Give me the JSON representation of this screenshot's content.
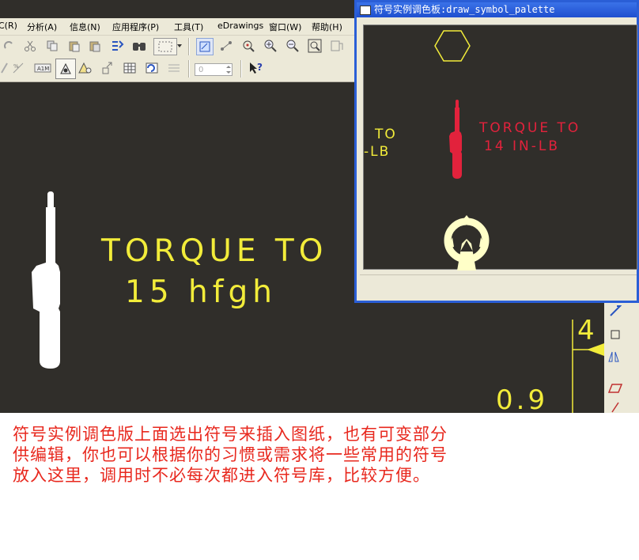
{
  "menu": {
    "items": [
      "C(R)",
      "分析(A)",
      "信息(N)",
      "应用程序(P)",
      "工具(T)",
      "eDrawings",
      "窗口(W)",
      "帮助(H)"
    ]
  },
  "toolbar": {
    "spin_value": "0"
  },
  "canvas": {
    "symbol_line1": "TORQUE TO",
    "symbol_line2": "15 hfgh",
    "dim_right_top": "4",
    "dim_right_bottom": "0.9"
  },
  "palette": {
    "title": "符号实例调色板:draw_symbol_palette",
    "partial_text_line1": "TO",
    "partial_text_line2": "-LB",
    "torque_line1": "TORQUE TO",
    "torque_line2": "14 IN-LB"
  },
  "caption": {
    "line1": "符号实例调色版上面选出符号来插入图纸，也有可变部分",
    "line2": "供编辑，你也可以根据你的习惯或需求将一些常用的符号",
    "line3": "放入这里，调用时不必每次都进入符号库，比较方便。"
  },
  "colors": {
    "canvas_bg": "#302e2a",
    "symbol_yellow": "#f2ec3a",
    "symbol_red": "#e2223c",
    "caption_red": "#e8281e",
    "title_blue": "#2a5ed6"
  }
}
